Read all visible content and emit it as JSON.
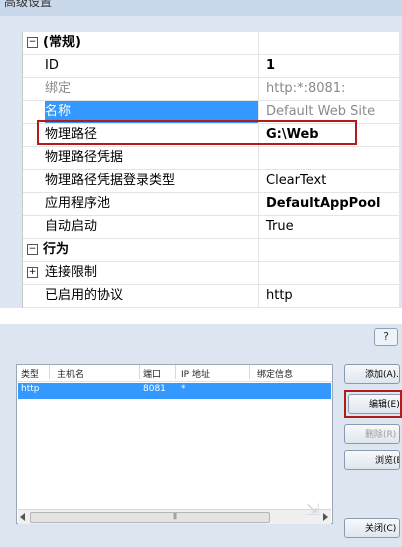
{
  "top_window": {
    "title": "高级设置",
    "categories": [
      {
        "label": "(常规)",
        "toggle": "−",
        "properties": [
          {
            "name": "ID",
            "value": "1",
            "style": "bold"
          },
          {
            "name": "绑定",
            "value": "http:*:8081:",
            "style": "dim"
          },
          {
            "name": "名称",
            "value": "Default Web Site",
            "style": "selected"
          },
          {
            "name": "物理路径",
            "value": "G:\\Web",
            "style": "highlight"
          },
          {
            "name": "物理路径凭据",
            "value": ""
          },
          {
            "name": "物理路径凭据登录类型",
            "value": "ClearText"
          },
          {
            "name": "应用程序池",
            "value": "DefaultAppPool",
            "style": "bold"
          },
          {
            "name": "自动启动",
            "value": "True"
          }
        ]
      },
      {
        "label": "行为",
        "toggle": "−",
        "properties": [
          {
            "name": "连接限制",
            "value": "",
            "toggle": "+"
          },
          {
            "name": "已启用的协议",
            "value": "http"
          }
        ]
      }
    ]
  },
  "bindings_dialog": {
    "help_label": "?",
    "columns": [
      "类型",
      "主机名",
      "端口",
      "IP 地址",
      "绑定信息"
    ],
    "rows": [
      {
        "type": "http",
        "host": "",
        "port": "8081",
        "ip": "*",
        "info": ""
      }
    ],
    "buttons": {
      "add": "添加(A)...",
      "edit": "编辑(E)...",
      "remove": "删除(R)",
      "browse": "浏览(B)",
      "close": "关闭(C)"
    },
    "colors": {
      "selection": "#3399ff",
      "highlight_border": "#b01b1b"
    }
  }
}
